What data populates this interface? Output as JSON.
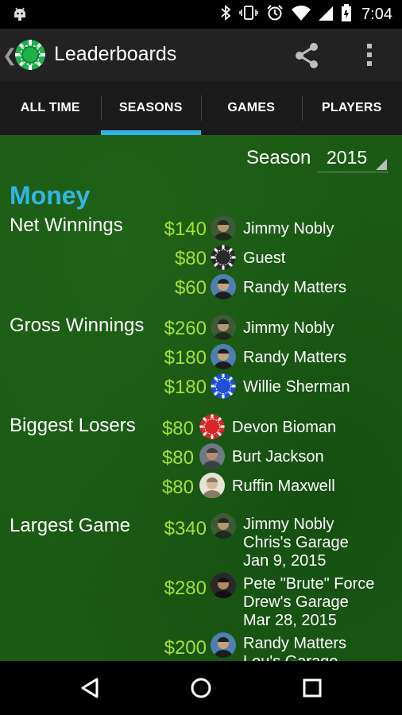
{
  "status_bar": {
    "time": "7:04",
    "icons": [
      "android-icon",
      "bluetooth-icon",
      "vibrate-icon",
      "alarm-icon",
      "wifi-icon",
      "signal-icon",
      "battery-icon"
    ]
  },
  "app_bar": {
    "title": "Leaderboards",
    "icons": [
      "back-chevron-icon",
      "poker-chip-logo",
      "share-icon",
      "overflow-menu-icon"
    ]
  },
  "tabs": [
    {
      "label": "ALL TIME",
      "active": false
    },
    {
      "label": "SEASONS",
      "active": true
    },
    {
      "label": "GAMES",
      "active": false
    },
    {
      "label": "PLAYERS",
      "active": false
    }
  ],
  "season": {
    "label": "Season",
    "value": "2015"
  },
  "section_title": "Money",
  "categories": [
    {
      "name": "Net Winnings",
      "entries": [
        {
          "amount": "$140",
          "lines": [
            "Jimmy Nobly"
          ],
          "avatar": "photo-green"
        },
        {
          "amount": "$80",
          "lines": [
            "Guest"
          ],
          "avatar": "chip-black"
        },
        {
          "amount": "$60",
          "lines": [
            "Randy Matters"
          ],
          "avatar": "photo-blue"
        }
      ]
    },
    {
      "name": "Gross Winnings",
      "entries": [
        {
          "amount": "$260",
          "lines": [
            "Jimmy Nobly"
          ],
          "avatar": "photo-green"
        },
        {
          "amount": "$180",
          "lines": [
            "Randy Matters"
          ],
          "avatar": "photo-blue"
        },
        {
          "amount": "$180",
          "lines": [
            "Willie Sherman"
          ],
          "avatar": "chip-blue"
        }
      ]
    },
    {
      "name": "Biggest Losers",
      "entries": [
        {
          "amount": "$80",
          "lines": [
            "Devon Bioman"
          ],
          "avatar": "chip-red"
        },
        {
          "amount": "$80",
          "lines": [
            "Burt Jackson"
          ],
          "avatar": "photo-gray"
        },
        {
          "amount": "$80",
          "lines": [
            "Ruffin Maxwell"
          ],
          "avatar": "photo-light"
        }
      ]
    },
    {
      "name": "Largest Game",
      "entries": [
        {
          "amount": "$340",
          "lines": [
            "Jimmy Nobly",
            "Chris's Garage",
            "Jan 9, 2015"
          ],
          "avatar": "photo-green"
        },
        {
          "amount": "$280",
          "lines": [
            "Pete \"Brute\" Force",
            "Drew's Garage",
            "Mar 28, 2015"
          ],
          "avatar": "photo-dark"
        },
        {
          "amount": "$200",
          "lines": [
            "Randy Matters",
            "Lou's Garage"
          ],
          "avatar": "photo-blue"
        }
      ]
    }
  ],
  "nav_bar": {
    "icons": [
      "back-triangle-icon",
      "home-circle-icon",
      "recents-square-icon"
    ]
  }
}
